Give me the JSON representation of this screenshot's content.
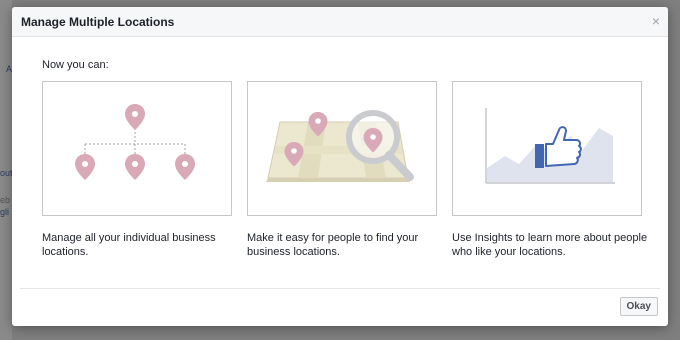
{
  "background": {
    "fragments": [
      "A",
      "out",
      "eb",
      "gli"
    ]
  },
  "dialog": {
    "title": "Manage Multiple Locations",
    "close_glyph": "×",
    "intro": "Now you can:",
    "features": [
      {
        "icon": "location-hierarchy-icon",
        "caption": "Manage all your individual business locations."
      },
      {
        "icon": "map-search-icon",
        "caption": "Make it easy for people to find your business locations."
      },
      {
        "icon": "insights-like-chart-icon",
        "caption": "Use Insights to learn more about people who like your locations."
      }
    ],
    "okay_label": "Okay"
  },
  "colors": {
    "pin": "#d9a9b8",
    "map": "#ece7cf",
    "accent_blue": "#4267b2",
    "chart_area": "#dfe3ee"
  }
}
